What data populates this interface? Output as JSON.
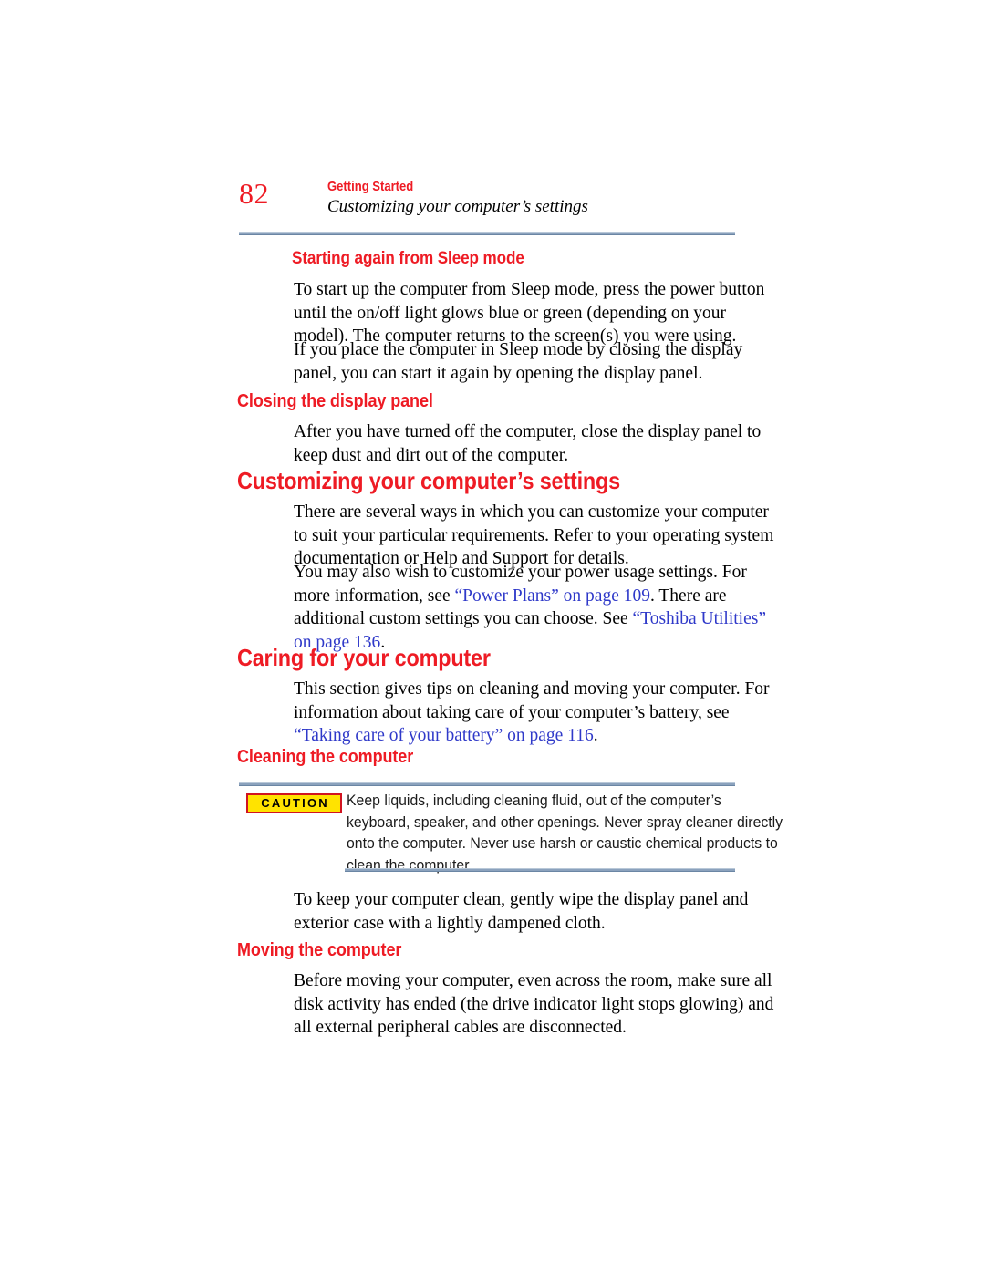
{
  "page": {
    "folio": "82",
    "chapter": "Getting Started",
    "section": "Customizing your computer’s settings"
  },
  "sections": {
    "sleep_heading": "Starting again from Sleep mode",
    "sleep_p1": {
      "l1": "To start up the computer from Sleep mode, press the power button",
      "l2": "until the on/off light glows blue or green (depending on your",
      "l3": "model). The computer returns to the screen(s) you were using."
    },
    "sleep_p2": {
      "l1": "If you place the computer in Sleep mode by closing the display",
      "l2": "panel, you can start it again by opening the display panel."
    },
    "closing_heading": "Closing the display panel",
    "closing_p1": {
      "l1": "After you have turned off the computer, close the display panel to",
      "l2": "keep dust and dirt out of the computer."
    },
    "customizing_heading": "Customizing your computer’s settings",
    "customizing_p1": {
      "l1": "There are several ways in which you can customize your computer",
      "l2": "to suit your particular requirements. Refer to your operating system",
      "l3": "documentation or Help and Support for details."
    },
    "customizing_p2": {
      "l1a": "You may also wish to customize your power usage settings. For",
      "l2a": "more information, see ",
      "l2link": "“Power Plans” on page 109",
      "l2b": ". There are",
      "l3a": "additional custom settings you can choose. See ",
      "l3link": "“Toshiba Utilities”",
      "l4link": "on page 136",
      "l4b": "."
    },
    "caring_heading": "Caring for your computer",
    "caring_p1": {
      "l1": "This section gives tips on cleaning and moving your computer. For",
      "l2": "information about taking care of your computer’s battery, see",
      "l3link": "“Taking care of your battery” on page 116",
      "l3b": "."
    },
    "cleaning_heading": "Cleaning the computer",
    "caution": {
      "badge_label": "CAUTION",
      "l1": "Keep liquids, including cleaning fluid, out of the computer’s",
      "l2": "keyboard, speaker, and other openings. Never spray cleaner directly",
      "l3": "onto the computer. Never use harsh or caustic chemical products to",
      "l4": "clean the computer."
    },
    "cleaning_p1": {
      "l1": "To keep your computer clean, gently wipe the display panel and",
      "l2": "exterior case with a lightly dampened cloth."
    },
    "moving_heading": "Moving the computer",
    "moving_p1": {
      "l1": "Before moving your computer, even across the room, make sure all",
      "l2": "disk activity has ended (the drive indicator light stops glowing) and",
      "l3": "all external peripheral cables are disconnected."
    }
  },
  "colors": {
    "heading_red": "#ee1b24",
    "link_blue": "#2f39c9",
    "rule_blue": "#8ba2bd",
    "caution_yellow": "#ffe300",
    "caution_border_red": "#d11421"
  }
}
